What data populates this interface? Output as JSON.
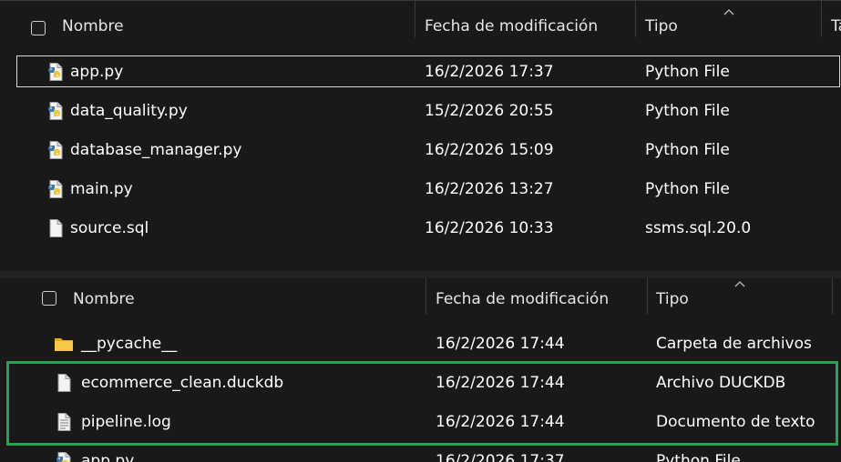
{
  "top_panel": {
    "columns": {
      "name": "Nombre",
      "date": "Fecha de modificación",
      "type": "Tipo",
      "size": "Ta"
    },
    "files": [
      {
        "name": "app.py",
        "date": "16/2/2026 17:37",
        "type": "Python File",
        "icon": "python-file-icon"
      },
      {
        "name": "data_quality.py",
        "date": "15/2/2026 20:55",
        "type": "Python File",
        "icon": "python-file-icon"
      },
      {
        "name": "database_manager.py",
        "date": "16/2/2026 15:09",
        "type": "Python File",
        "icon": "python-file-icon"
      },
      {
        "name": "main.py",
        "date": "16/2/2026 13:27",
        "type": "Python File",
        "icon": "python-file-icon"
      },
      {
        "name": "source.sql",
        "date": "16/2/2026 10:33",
        "type": "ssms.sql.20.0",
        "icon": "generic-file-icon"
      }
    ]
  },
  "bottom_panel": {
    "columns": {
      "name": "Nombre",
      "date": "Fecha de modificación",
      "type": "Tipo"
    },
    "files": [
      {
        "name": "__pycache__",
        "date": "16/2/2026 17:44",
        "type": "Carpeta de archivos",
        "icon": "folder-icon"
      },
      {
        "name": "ecommerce_clean.duckdb",
        "date": "16/2/2026 17:44",
        "type": "Archivo DUCKDB",
        "icon": "generic-file-icon"
      },
      {
        "name": "pipeline.log",
        "date": "16/2/2026 17:44",
        "type": "Documento de texto",
        "icon": "text-file-icon"
      },
      {
        "name": "app.py",
        "date": "16/2/2026 17:37",
        "type": "Python File",
        "icon": "python-file-icon"
      }
    ]
  },
  "colors": {
    "background": "#191919",
    "highlight": "#22a64a",
    "selection_border": "#d9d9d9",
    "folder": "#f4c542"
  }
}
